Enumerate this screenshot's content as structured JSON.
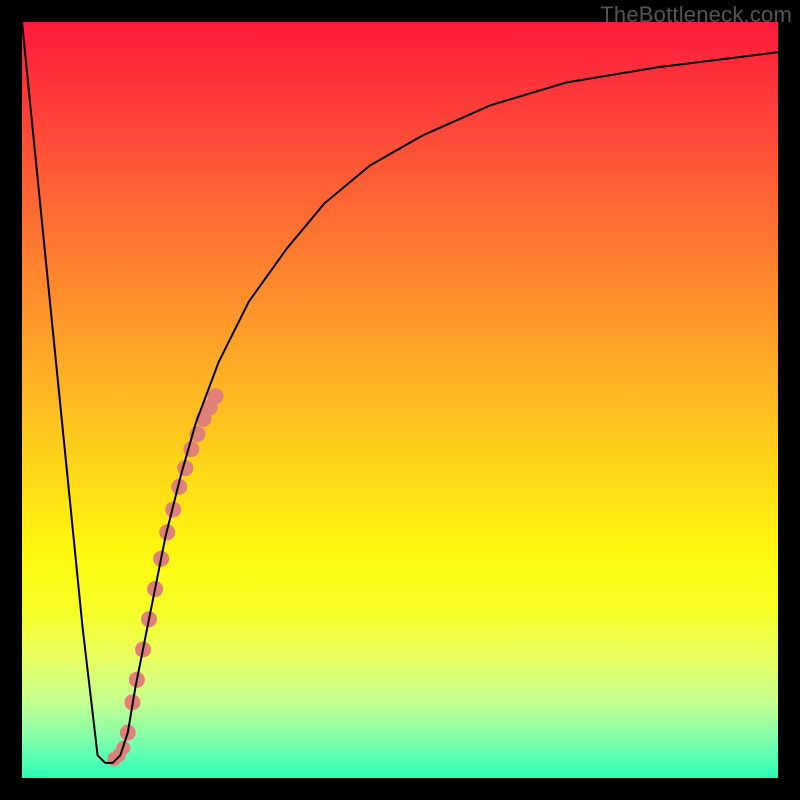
{
  "watermark": "TheBottleneck.com",
  "chart_data": {
    "type": "line",
    "title": "",
    "xlabel": "",
    "ylabel": "",
    "xlim": [
      0,
      100
    ],
    "ylim": [
      0,
      100
    ],
    "grid": false,
    "legend": false,
    "gradient_stops": [
      {
        "pct": 0,
        "color": "#ff1a3d"
      },
      {
        "pct": 10,
        "color": "#ff3a3a"
      },
      {
        "pct": 20,
        "color": "#ff5a36"
      },
      {
        "pct": 30,
        "color": "#ff7a30"
      },
      {
        "pct": 40,
        "color": "#ff9a2a"
      },
      {
        "pct": 50,
        "color": "#ffba22"
      },
      {
        "pct": 60,
        "color": "#ffd918"
      },
      {
        "pct": 70,
        "color": "#fff80e"
      },
      {
        "pct": 78,
        "color": "#f6ff28"
      },
      {
        "pct": 84,
        "color": "#e9ff60"
      },
      {
        "pct": 90,
        "color": "#c4ff90"
      },
      {
        "pct": 95,
        "color": "#7effac"
      },
      {
        "pct": 100,
        "color": "#2bffb5"
      }
    ],
    "series": [
      {
        "name": "bottleneck-curve",
        "stroke": "#000000",
        "stroke_width": 2,
        "x": [
          0,
          2,
          4,
          6,
          8,
          10,
          11,
          12,
          13,
          14,
          15,
          17,
          19,
          21,
          23,
          26,
          30,
          35,
          40,
          46,
          53,
          62,
          72,
          84,
          100
        ],
        "y": [
          100,
          80,
          60,
          40,
          20,
          3,
          2,
          2,
          3,
          6,
          12,
          22,
          32,
          40,
          47,
          55,
          63,
          70,
          76,
          81,
          85,
          89,
          92,
          94,
          96
        ]
      }
    ],
    "markers": [
      {
        "name": "highlighted-dots",
        "color": "#e08078",
        "radius": 8,
        "x": [
          14.0,
          14.6,
          15.2,
          16.0,
          16.8,
          17.6,
          18.4,
          19.2,
          20.0,
          20.8,
          21.6,
          22.4,
          23.2,
          24.0,
          24.8,
          25.6
        ],
        "y": [
          6.0,
          10.0,
          13.0,
          17.0,
          21.0,
          25.0,
          29.0,
          32.5,
          35.5,
          38.5,
          41.0,
          43.5,
          45.5,
          47.5,
          49.0,
          50.5
        ]
      },
      {
        "name": "lower-dots",
        "color": "#e08078",
        "radius": 7,
        "x": [
          12.2,
          12.8,
          13.4
        ],
        "y": [
          2.5,
          3.0,
          4.0
        ]
      }
    ]
  }
}
